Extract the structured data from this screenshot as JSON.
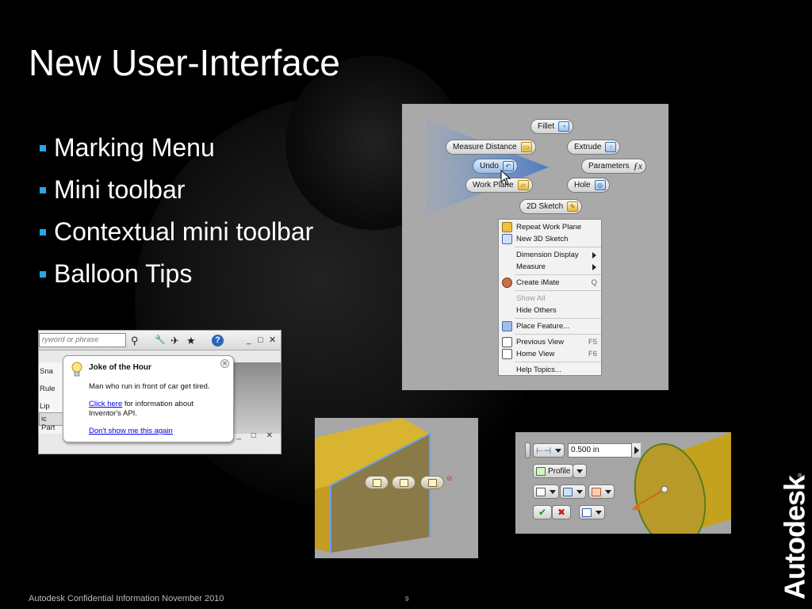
{
  "slide": {
    "title": "New User-Interface",
    "bullets": [
      "Marking Menu",
      "Mini toolbar",
      "Contextual mini toolbar",
      "Balloon Tips"
    ],
    "footer": "Autodesk Confidential Information November 2010",
    "page_number": "9",
    "logo_text": "Autodesk",
    "bullet_color": "#29a8e0"
  },
  "marking_menu": {
    "radial_items": {
      "fillet": "Fillet",
      "measure_distance": "Measure Distance",
      "extrude": "Extrude",
      "undo": "Undo",
      "parameters": "Parameters",
      "work_plane": "Work Plane",
      "hole": "Hole",
      "sketch_2d": "2D Sketch"
    },
    "context_menu": {
      "repeat_work_plane": "Repeat Work Plane",
      "new_3d_sketch": "New 3D Sketch",
      "dimension_display": "Dimension Display",
      "measure": "Measure",
      "create_imate": "Create iMate",
      "create_imate_shortcut": "Q",
      "show_all": "Show All",
      "hide_others": "Hide Others",
      "place_feature": "Place Feature...",
      "previous_view": "Previous View",
      "previous_view_shortcut": "F5",
      "home_view": "Home View",
      "home_view_shortcut": "F6",
      "help_topics": "Help Topics..."
    }
  },
  "balloon_tip": {
    "search_placeholder": "ryword or phrase",
    "left_list": [
      "Sna",
      "Rule",
      "Lip"
    ],
    "part_label": "ic Part",
    "title": "Joke of the Hour",
    "message": "Man who run in front of car get tired.",
    "link_text": "Click here",
    "link_suffix": " for information about Inventor's API.",
    "dont_show": "Don't show me this again"
  },
  "contextual_toolbar": {
    "distance_value": "0.500 in",
    "profile_label": "Profile"
  },
  "icons": {
    "help": "?",
    "star": "★",
    "binoculars": "⚲",
    "wrench": "🔧",
    "close": "✕",
    "minimize": "_",
    "maximize": "□",
    "window_controls": "_ □ ✕",
    "ok": "✔",
    "cancel": "✖"
  }
}
